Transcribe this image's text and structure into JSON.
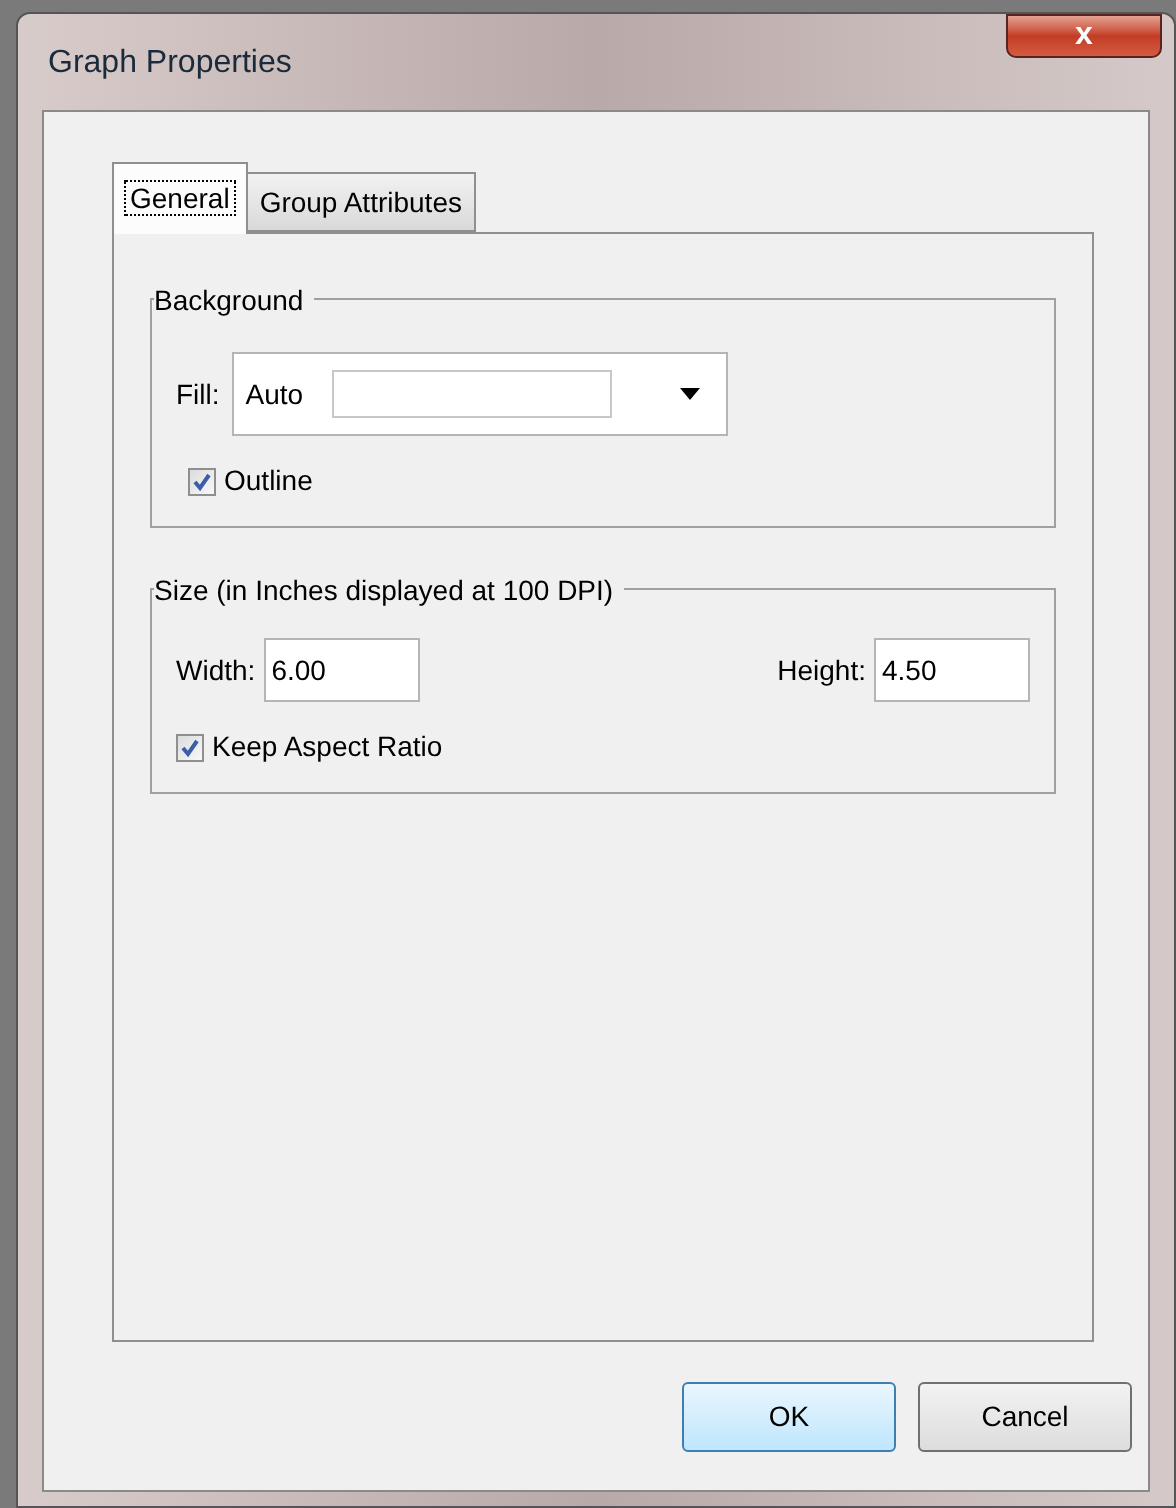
{
  "window": {
    "title": "Graph Properties",
    "close": "x"
  },
  "tabs": [
    {
      "label": "General",
      "selected": true
    },
    {
      "label": "Group Attributes",
      "selected": false
    }
  ],
  "background_group": {
    "title": "Background",
    "fill_label": "Fill:",
    "fill_value": "Auto",
    "outline": {
      "label": "Outline",
      "checked": true
    }
  },
  "size_group": {
    "title": "Size (in Inches displayed at 100 DPI)",
    "width_label": "Width:",
    "width_value": "6.00",
    "height_label": "Height:",
    "height_value": "4.50",
    "keep_aspect": {
      "label": "Keep Aspect Ratio",
      "checked": true
    }
  },
  "buttons": [
    {
      "label": "OK",
      "default": true
    },
    {
      "label": "Cancel",
      "default": false
    }
  ]
}
